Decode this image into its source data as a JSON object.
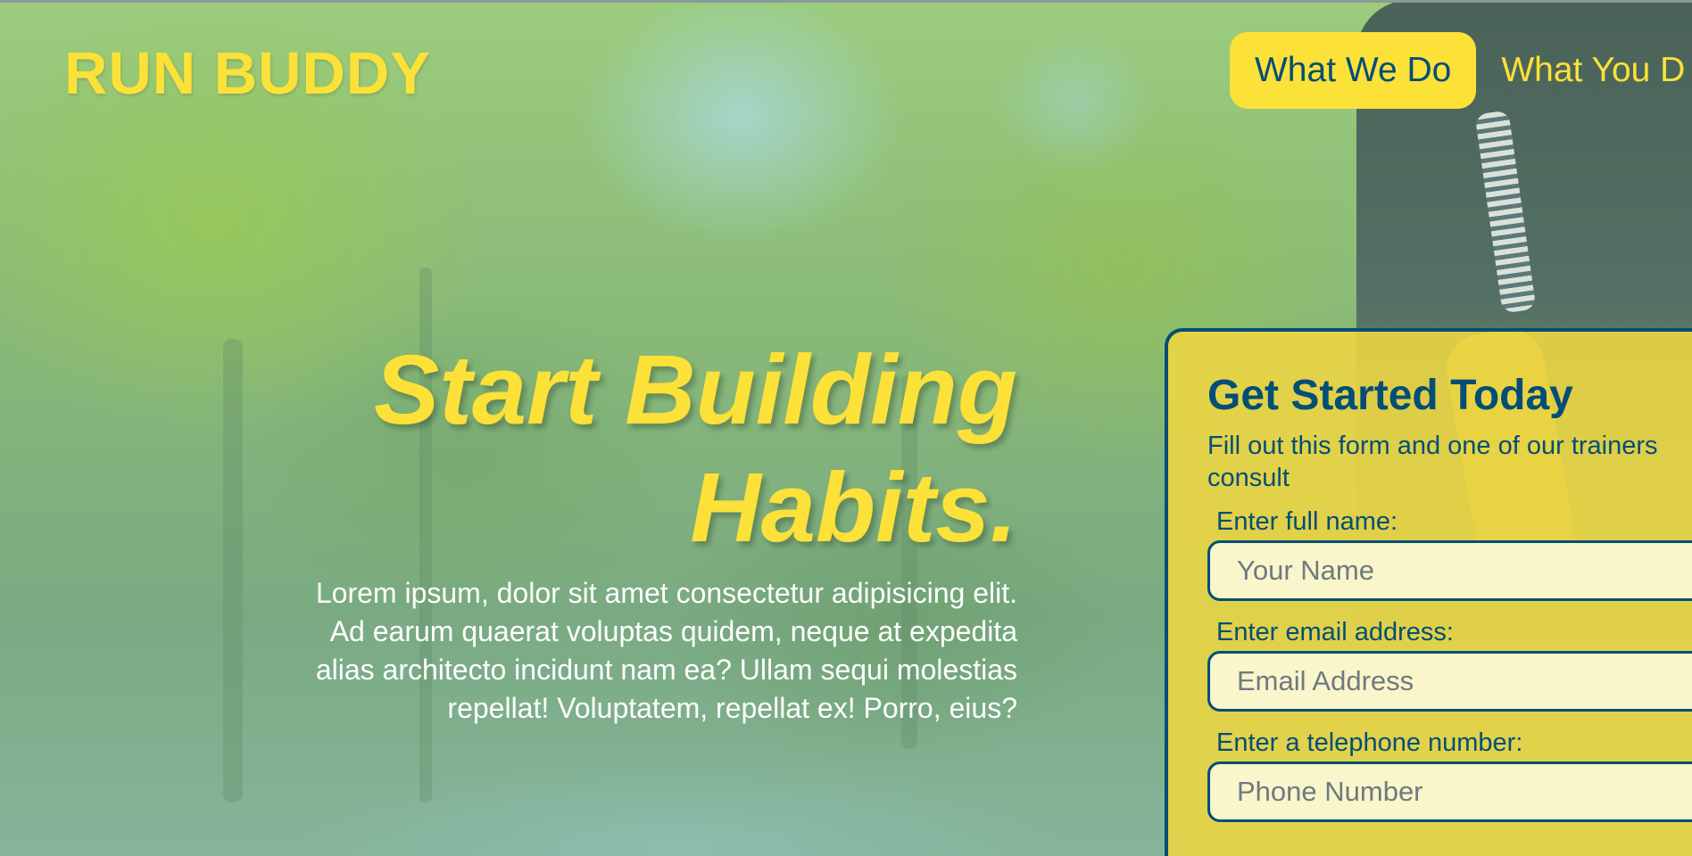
{
  "header": {
    "logo": "RUN BUDDY",
    "nav": [
      {
        "label": "What We Do",
        "active": true
      },
      {
        "label": "What You D",
        "active": false
      }
    ]
  },
  "hero": {
    "title_line1": "Start Building",
    "title_line2": "Habits.",
    "description": "Lorem ipsum, dolor sit amet consectetur adipisicing elit. Ad earum quaerat voluptas quidem, neque at expedita alias architecto incidunt nam ea? Ullam sequi molestias repellat! Voluptatem, repellat ex! Porro, eius?"
  },
  "form": {
    "title": "Get Started Today",
    "description": "Fill out this form and one of our trainers consult",
    "fields": [
      {
        "label": "Enter full name:",
        "placeholder": "Your Name"
      },
      {
        "label": "Enter email address:",
        "placeholder": "Email Address"
      },
      {
        "label": "Enter a telephone number:",
        "placeholder": "Phone Number"
      }
    ]
  },
  "colors": {
    "accent_yellow": "#fce138",
    "primary_blue": "#024e76",
    "text_white": "#ffffff"
  }
}
